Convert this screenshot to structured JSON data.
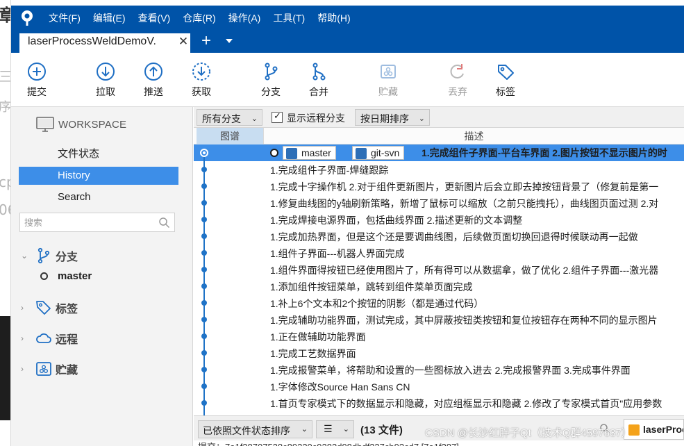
{
  "menubar": {
    "items": [
      "文件(F)",
      "编辑(E)",
      "查看(V)",
      "仓库(R)",
      "操作(A)",
      "工具(T)",
      "帮助(H)"
    ]
  },
  "tabbar": {
    "repo_tab": "laserProcessWeldDemoV.",
    "close": "✕",
    "add": "+"
  },
  "toolbar": {
    "commit": "提交",
    "pull": "拉取",
    "push": "推送",
    "fetch": "获取",
    "branch": "分支",
    "merge": "合并",
    "stash": "贮藏",
    "discard": "丢弃",
    "tag": "标签"
  },
  "sidebar": {
    "workspace": "WORKSPACE",
    "file_status": "文件状态",
    "history": "History",
    "search": "Search",
    "search_placeholder": "搜索",
    "branches": "分支",
    "current_branch": "master",
    "tags": "标签",
    "remotes": "远程",
    "stashes": "贮藏"
  },
  "filters": {
    "branch_filter": "所有分支",
    "show_remote": "显示远程分支",
    "show_remote_checked": true,
    "order": "按日期排序"
  },
  "columns": {
    "graph": "图谱",
    "description": "描述"
  },
  "refs": {
    "local": "master",
    "remote": "git-svn"
  },
  "commits": [
    "1.完成组件子界面-平台车界面 2.图片按钮不显示图片的时",
    "1.完成组件子界面-焊缝跟踪",
    "1.完成十字操作机 2.对于组件更新图片，更新图片后会立即去掉按钮背景了（修复前是第一",
    "1.修复曲线图的y轴刷新策略，新增了鼠标可以缩放（之前只能拽托），曲线图页面过测 2.对",
    "1.完成焊接电源界面，包括曲线界面 2.描述更新的文本调整",
    "1.完成加热界面，但是这个还是要调曲线图，后续做页面切换回退得时候联动再一起做",
    "1.组件子界面---机器人界面完成",
    "1.组件界面得按钮已经使用图片了，所有得可以从数据拿，做了优化 2.组件子界面---激光器",
    "1.添加组件按钮菜单，跳转到组件菜单页面完成",
    "1.补上6个文本和2个按钮的阴影（都是通过代码）",
    "1.完成辅助功能界面，测试完成，其中屏蔽按钮类按钮和复位按钮存在两种不同的显示图片",
    "1.正在做辅助功能界面",
    "1.完成工艺数据界面",
    "1.完成报警菜单，将帮助和设置的一些图标放入进去 2.完成报警界面 3.完成事件界面",
    "1.字体修改Source Han Sans CN",
    "1.首页专家模式下的数据显示和隐藏，对应组框显示和隐藏 2.修改了专家模式首页\"应用参数"
  ],
  "bottom": {
    "sort": "已依照文件状态排序",
    "view_icon": "☰",
    "file_count": "(13 文件)",
    "preview_tab": "laserProc",
    "detail": "提交：7a1f38707528c89230c9283d98dbdf337cb93cd7 [7a1f387]"
  },
  "watermark": "CSDN @长沙红胖子Qt（技术Q群4597637）",
  "colors": {
    "menubar_bg": "#0053a8",
    "selection": "#3d8ee8",
    "graph_line": "#1f73c7",
    "ref_icon": "#2e6fb7"
  }
}
